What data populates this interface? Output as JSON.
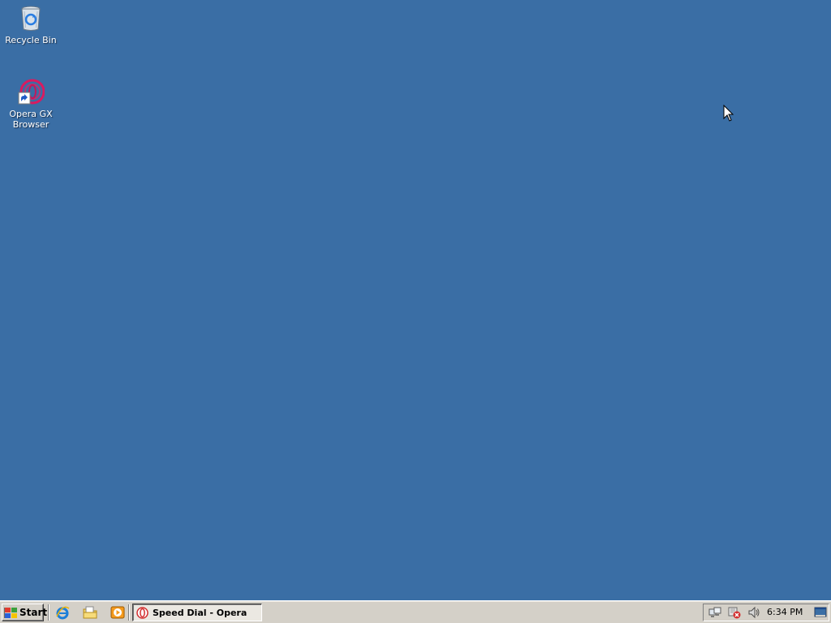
{
  "desktop": {
    "background_color": "#3a6ea5",
    "icons": [
      {
        "label": "Recycle Bin",
        "icon": "recycle-bin-icon"
      },
      {
        "label": "Opera GX\nBrowser",
        "icon": "opera-gx-icon"
      }
    ]
  },
  "taskbar": {
    "start_label": "Start",
    "quick_launch": [
      {
        "icon": "internet-explorer-icon"
      },
      {
        "icon": "windows-explorer-icon"
      },
      {
        "icon": "media-player-icon"
      }
    ],
    "tasks": [
      {
        "label": "Speed Dial - Opera",
        "icon": "opera-icon",
        "active": true
      }
    ],
    "tray": {
      "icons": [
        "network-icon",
        "security-alert-icon",
        "volume-icon",
        "show-desktop-icon"
      ],
      "clock": "6:34 PM"
    }
  }
}
